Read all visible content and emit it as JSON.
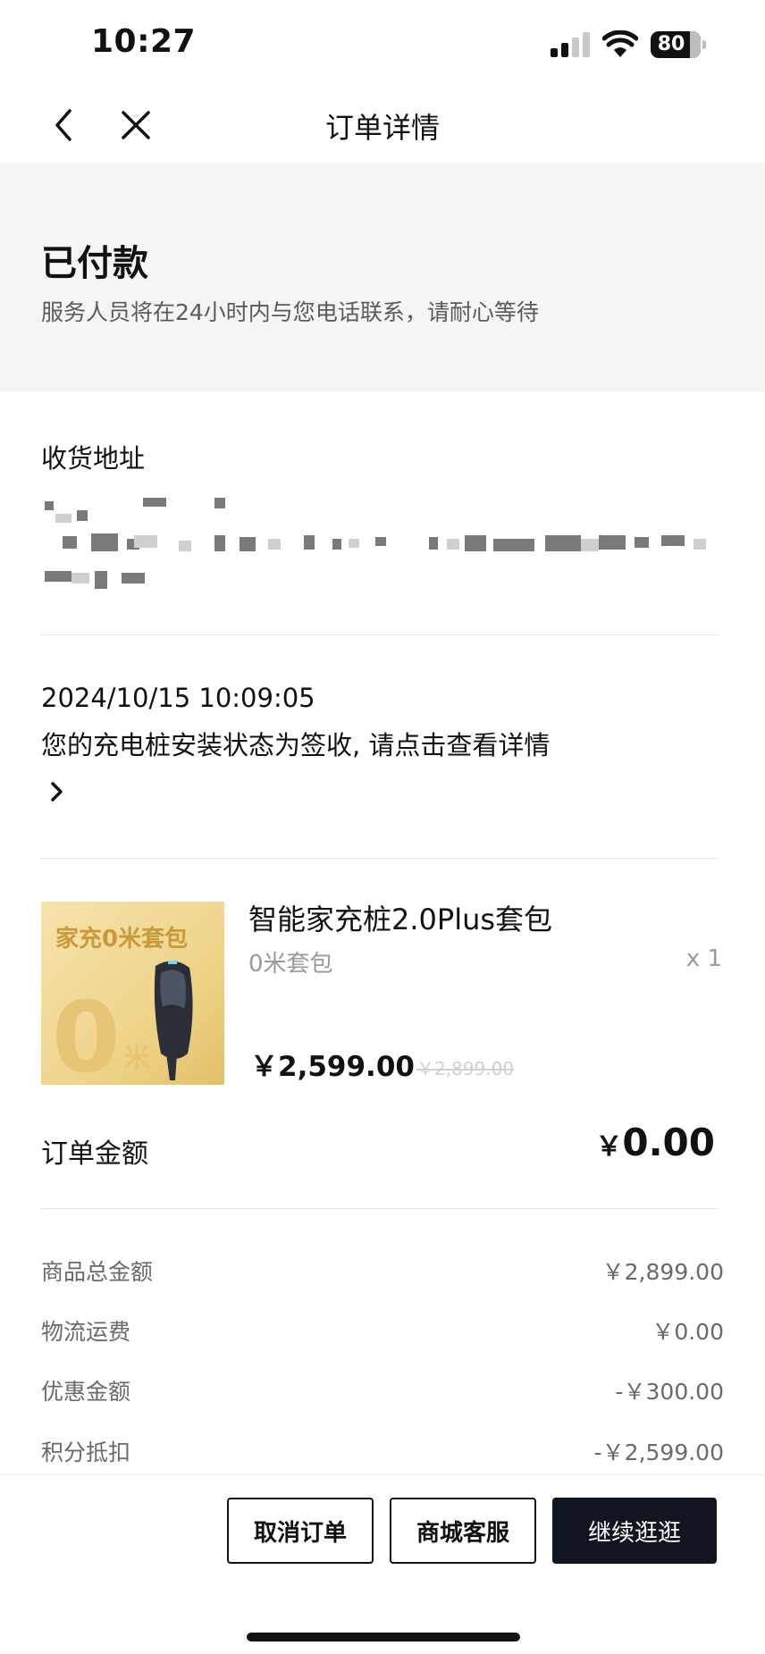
{
  "status_bar": {
    "time": "10:27",
    "battery": "80"
  },
  "nav": {
    "title": "订单详情"
  },
  "order_status": {
    "title": "已付款",
    "description": "服务人员将在24小时内与您电话联系，请耐心等待"
  },
  "address": {
    "label": "收货地址"
  },
  "install": {
    "timestamp": "2024/10/15 10:09:05",
    "message": "您的充电桩安装状态为签收, 请点击查看详情"
  },
  "product": {
    "name": "智能家充桩2.0Plus套包",
    "spec": "0米套包",
    "quantity": "x 1",
    "price": "￥2,599.00",
    "original_price": "￥2,899.00",
    "image_text": "家充0米套包",
    "image_big_zero": "0",
    "image_unit": "米"
  },
  "order_amount": {
    "label": "订单金额",
    "currency": "￥",
    "value": "0.00"
  },
  "fees": [
    {
      "label": "商品总金额",
      "value": "￥2,899.00"
    },
    {
      "label": "物流运费",
      "value": "￥0.00"
    },
    {
      "label": "优惠金额",
      "value": "-￥300.00"
    },
    {
      "label": "积分抵扣",
      "value": "-￥2,599.00"
    }
  ],
  "actions": {
    "cancel": "取消订单",
    "service": "商城客服",
    "continue": "继续逛逛"
  },
  "colors": {
    "primary_button": "#111520",
    "banner_bg": "#f5f5f5",
    "thumb_gold": "#e8c97a"
  },
  "icons": [
    "back-arrow-icon",
    "close-icon",
    "chevron-right-icon",
    "signal-icon",
    "wifi-icon",
    "battery-icon"
  ]
}
